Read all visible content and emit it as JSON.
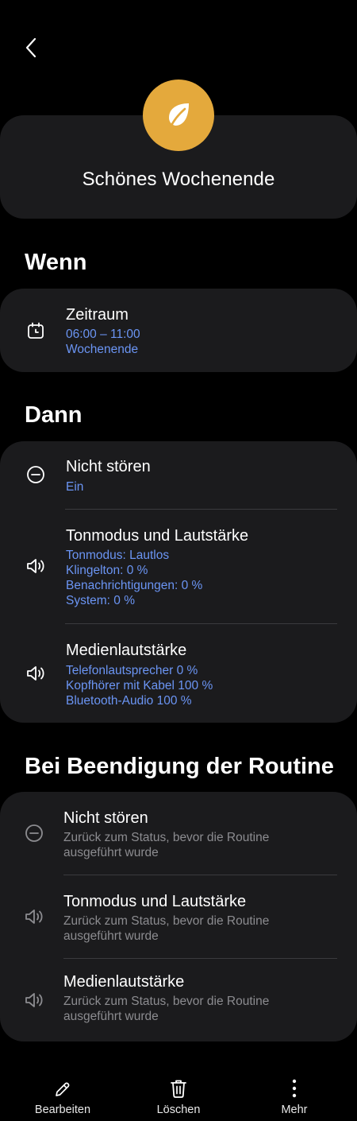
{
  "routine": {
    "title": "Schönes Wochenende",
    "icon": "leaf-icon",
    "icon_color": "#e4a93c"
  },
  "wenn": {
    "heading": "Wenn",
    "items": [
      {
        "title": "Zeitraum",
        "lines": [
          "06:00 – 11:00",
          "Wochenende"
        ],
        "icon": "calendar-clock-icon"
      }
    ]
  },
  "dann": {
    "heading": "Dann",
    "items": [
      {
        "title": "Nicht stören",
        "lines": [
          "Ein"
        ],
        "icon": "do-not-disturb-icon"
      },
      {
        "title": "Tonmodus und Lautstärke",
        "lines": [
          "Tonmodus: Lautlos",
          "Klingelton: 0 %",
          "Benachrichtigungen: 0 %",
          "System: 0 %"
        ],
        "icon": "speaker-icon"
      },
      {
        "title": "Medienlautstärke",
        "lines": [
          "Telefonlautsprecher 0 %",
          "Kopfhörer mit Kabel 100 %",
          "Bluetooth-Audio 100 %"
        ],
        "icon": "speaker-icon"
      }
    ]
  },
  "ende": {
    "heading": "Bei Beendigung der Routine",
    "items": [
      {
        "title": "Nicht stören",
        "lines": [
          "Zurück zum Status, bevor die Routine",
          "ausgeführt wurde"
        ],
        "icon": "do-not-disturb-icon"
      },
      {
        "title": "Tonmodus und Lautstärke",
        "lines": [
          "Zurück zum Status, bevor die Routine",
          "ausgeführt wurde"
        ],
        "icon": "speaker-icon"
      },
      {
        "title": "Medienlautstärke",
        "lines": [
          "Zurück zum Status, bevor die Routine",
          "ausgeführt wurde"
        ],
        "icon": "speaker-icon"
      }
    ]
  },
  "bottom_bar": {
    "edit_label": "Bearbeiten",
    "delete_label": "Löschen",
    "more_label": "Mehr"
  },
  "colors": {
    "accent_text": "#6b95f4",
    "secondary_text": "#8c8c90",
    "card_bg": "#1b1b1d"
  }
}
